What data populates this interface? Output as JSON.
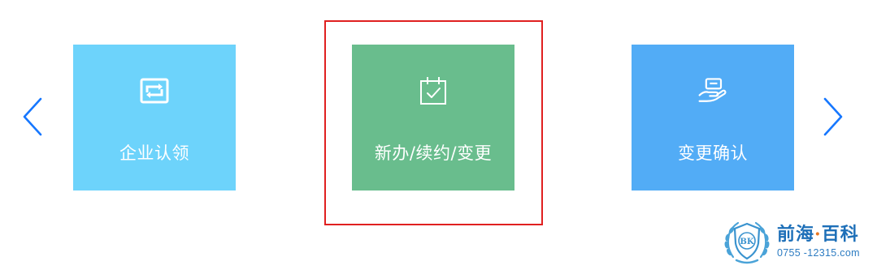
{
  "carousel": {
    "prev_icon": "chevron-left-icon",
    "next_icon": "chevron-right-icon",
    "arrow_color": "#1677ff",
    "cards": [
      {
        "label": "企业认领",
        "icon": "refresh-square-icon",
        "color": "#6dd3fb"
      },
      {
        "label": "新办/续约/变更",
        "icon": "calendar-check-icon",
        "color": "#69bd8d",
        "selected": true
      },
      {
        "label": "变更确认",
        "icon": "hand-card-icon",
        "color": "#52acf6"
      }
    ],
    "selection_color": "#e02020"
  },
  "watermark": {
    "brand_part1": "前海",
    "separator": "·",
    "brand_part2": "百科",
    "subtitle": "0755 -12315.com",
    "seal_text": "BK",
    "icon": "laurel-shield-icon"
  }
}
